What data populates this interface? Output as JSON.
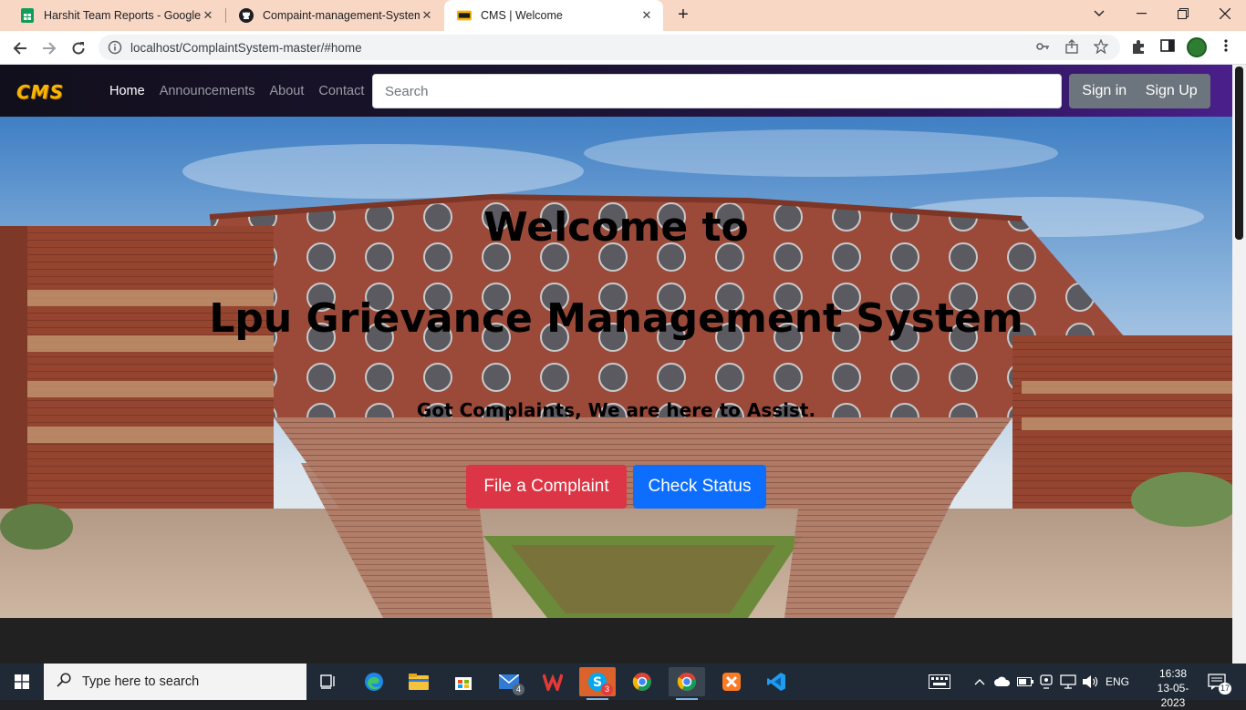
{
  "browser": {
    "tabs": [
      {
        "title": "Harshit Team Reports - Google Sl",
        "favicon": "google-sheets-icon",
        "active": false
      },
      {
        "title": "Compaint-management-System-",
        "favicon": "github-icon",
        "active": false
      },
      {
        "title": "CMS | Welcome",
        "favicon": "cms-icon",
        "active": true
      }
    ],
    "close_glyph": "✕",
    "new_tab_glyph": "+",
    "url": "localhost/ComplaintSystem-master/#home"
  },
  "site": {
    "logo": "CMS",
    "nav": [
      {
        "label": "Home",
        "active": true
      },
      {
        "label": "Announcements",
        "active": false
      },
      {
        "label": "About",
        "active": false
      },
      {
        "label": "Contact",
        "active": false
      }
    ],
    "search_placeholder": "Search",
    "sign_in": "Sign in",
    "sign_up": "Sign Up"
  },
  "hero": {
    "title_line1": "Welcome to",
    "title_line2": "Lpu Grievance Management System",
    "subtitle": "Got Complaints, We are here to Assist.",
    "primary_button": "File a Complaint",
    "secondary_button": "Check Status"
  },
  "taskbar": {
    "search_placeholder": "Type here to search",
    "mail_badge": "4",
    "skype_badge": "3",
    "language": "ENG",
    "time": "16:38",
    "date": "13-05-2023",
    "notification_count": "17"
  },
  "colors": {
    "tabbar": "#f8d7c4",
    "danger": "#dc3545",
    "primary": "#0d6efd",
    "logo": "#f7b500",
    "auth_group": "#6c757d"
  }
}
